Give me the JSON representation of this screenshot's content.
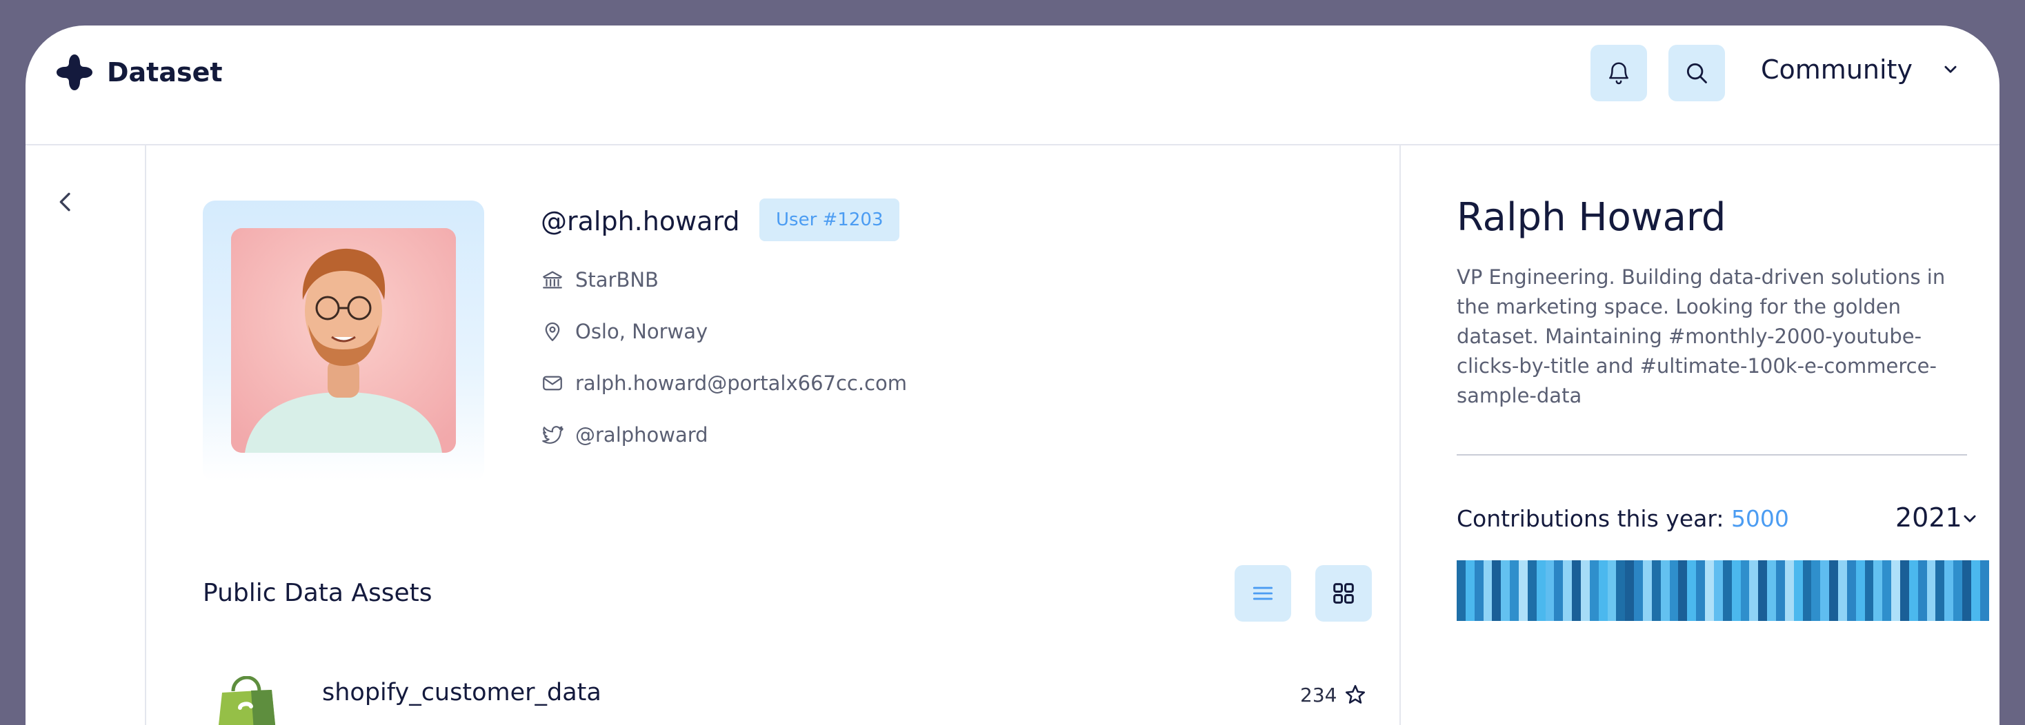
{
  "header": {
    "brand": "Dataset",
    "community_label": "Community",
    "icons": [
      "logo-icon",
      "bell-icon",
      "search-icon",
      "chevron-down-icon"
    ]
  },
  "profile": {
    "handle": "@ralph.howard",
    "user_badge": "User #1203",
    "company": "StarBNB",
    "location": "Oslo, Norway",
    "email": "ralph.howard@portalx667cc.com",
    "twitter": "@ralphoward",
    "full_name": "Ralph Howard",
    "bio": "VP Engineering. Building data-driven solutions in the marketing space. Looking for the golden dataset. Maintaining #monthly-2000-youtube-clicks-by-title and #ultimate-100k-e-commerce-sample-data"
  },
  "assets": {
    "section_title": "Public Data Assets",
    "items": [
      {
        "name": "shopify_customer_data",
        "stars": "234"
      }
    ]
  },
  "contributions": {
    "label": "Contributions this year: ",
    "count": "5000",
    "year": "2021",
    "colors": [
      "#1e6fa8",
      "#4bb8ee",
      "#2b85c4",
      "#8fd3f6",
      "#1a5f97",
      "#63c1f0",
      "#2f8fcc",
      "#aee0f9",
      "#1e6fa8",
      "#4bb8ee",
      "#5fbdf0",
      "#2b85c4",
      "#8fd3f6",
      "#1a5f97",
      "#a6dcf7",
      "#2f8fcc",
      "#4bb8ee",
      "#6bc6f1",
      "#1e6fa8",
      "#1a5f97",
      "#2b85c4",
      "#8fd3f6",
      "#1e6fa8",
      "#63c1f0",
      "#2f8fcc",
      "#1a5f97",
      "#4bb8ee",
      "#2b85c4",
      "#aee0f9",
      "#5fbdf0",
      "#1e6fa8",
      "#4bb8ee",
      "#2f8fcc",
      "#8fd3f6",
      "#1a5f97",
      "#63c1f0",
      "#2b85c4",
      "#a6dcf7",
      "#4bb8ee",
      "#1e6fa8",
      "#2f8fcc",
      "#5fbdf0",
      "#1a5f97",
      "#8fd3f6",
      "#2b85c4",
      "#4bb8ee",
      "#1e6fa8",
      "#63c1f0",
      "#2f8fcc",
      "#aee0f9",
      "#1a5f97",
      "#4bb8ee",
      "#2b85c4",
      "#8fd3f6",
      "#1e6fa8",
      "#5fbdf0",
      "#2f8fcc",
      "#1a5f97",
      "#4bb8ee",
      "#2b85c4"
    ]
  }
}
